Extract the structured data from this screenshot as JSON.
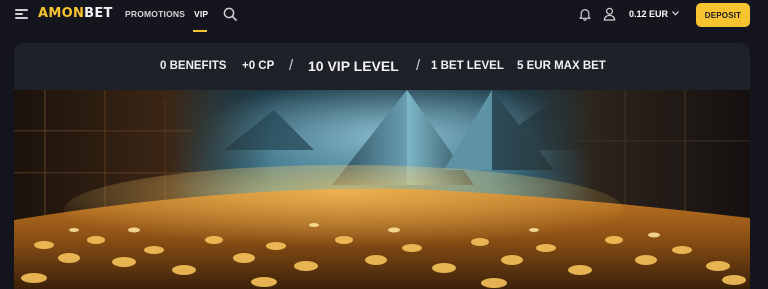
{
  "header": {
    "logo": {
      "part1": "AMON",
      "part2": "BET"
    },
    "nav": {
      "promotions": "PROMOTIONS",
      "vip": "VIP"
    },
    "balance": "0.12 EUR",
    "deposit_label": "DEPOSIT",
    "icons": [
      "menu-icon",
      "search-icon",
      "bell-icon",
      "user-icon",
      "chevron-down-icon"
    ],
    "accent_color": "#f7c331"
  },
  "vip": {
    "benefits": "0 BENEFITS",
    "cp": "+0 CP",
    "separator": "/",
    "level": "10 VIP LEVEL",
    "bet_level": "1 BET LEVEL",
    "max_bet": "5 EUR MAX BET"
  }
}
